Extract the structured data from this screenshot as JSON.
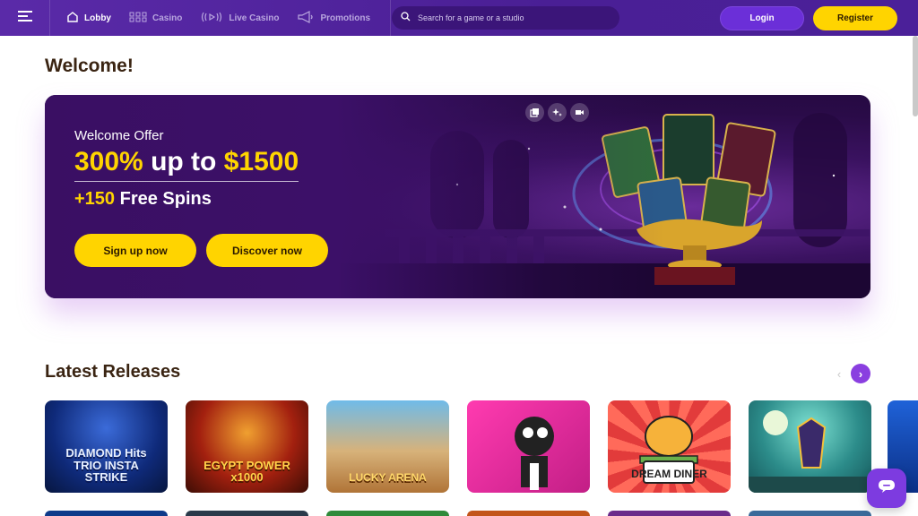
{
  "header": {
    "menu_icon": "hamburger-icon",
    "nav": [
      {
        "label": "Lobby",
        "icon": "home-icon",
        "active": true
      },
      {
        "label": "Casino",
        "icon": "grid-icon",
        "active": false
      },
      {
        "label": "Live Casino",
        "icon": "live-icon",
        "active": false
      },
      {
        "label": "Promotions",
        "icon": "megaphone-icon",
        "active": false
      }
    ],
    "search_placeholder": "Search for a game or a studio",
    "login_label": "Login",
    "register_label": "Register"
  },
  "welcome": {
    "title": "Welcome!"
  },
  "banner": {
    "offer_label": "Welcome Offer",
    "offer_percent": "300%",
    "offer_upto": " up to ",
    "offer_amount": "$1500",
    "spins_count": "+150",
    "spins_label": " Free Spins",
    "signup_label": "Sign up now",
    "discover_label": "Discover now",
    "media_icons": [
      "gallery-icon",
      "sparkle-icon",
      "video-icon"
    ]
  },
  "latest": {
    "title": "Latest Releases",
    "prev_label": "‹",
    "next_label": "›",
    "games": [
      {
        "title": "DIAMOND Hits TRIO INSTA STRIKE"
      },
      {
        "title": "EGYPT POWER x1000"
      },
      {
        "title": "LUCKY ARENA"
      },
      {
        "title": ""
      },
      {
        "title": "DREAM DINER"
      },
      {
        "title": ""
      }
    ]
  },
  "colors": {
    "brand": "#4a1f95",
    "accent": "#ffd400",
    "cta_next": "#8a3fe0"
  }
}
